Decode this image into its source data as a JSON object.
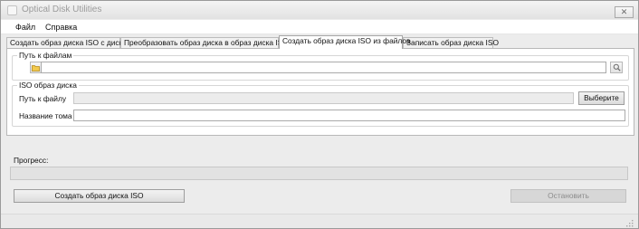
{
  "window": {
    "title": "Optical Disk Utilities",
    "close_glyph": "✕",
    "icons": {
      "app": "app-icon",
      "close": "close-icon",
      "grip": "resize-grip-icon"
    }
  },
  "menu": {
    "items": [
      {
        "label": "Файл"
      },
      {
        "label": "Справка"
      }
    ]
  },
  "tabs": {
    "active_index": 2,
    "items": [
      {
        "label": "Создать образ диска ISO с диска"
      },
      {
        "label": "Преобразовать образ диска в образ диска ISO"
      },
      {
        "label": "Создать образ диска ISO из файлов"
      },
      {
        "label": "Записать образ диска ISO"
      }
    ]
  },
  "files_group": {
    "legend": "Путь к файлам",
    "path_value": "",
    "icons": {
      "browse": "folder-icon",
      "search": "search-icon"
    }
  },
  "iso_group": {
    "legend": "ISO образ диска",
    "file_path_label": "Путь к файлу",
    "file_path_value": "",
    "browse_label": "Выберите",
    "volume_label": "Название тома",
    "volume_value": ""
  },
  "progress": {
    "label": "Прогресс:",
    "value": 0
  },
  "actions": {
    "create_label": "Создать образ диска ISO",
    "stop_label": "Остановить",
    "stop_enabled": false
  }
}
